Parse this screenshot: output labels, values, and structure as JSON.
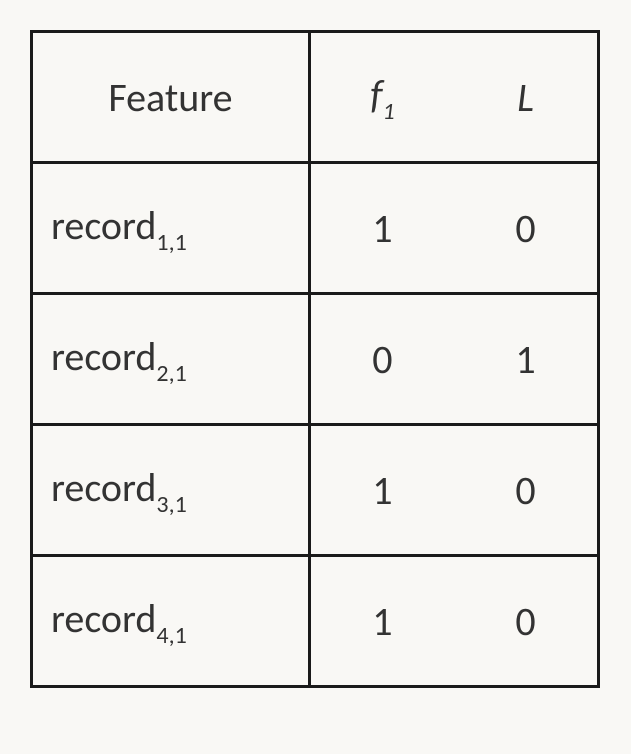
{
  "chart_data": {
    "type": "table",
    "columns": [
      "Feature",
      "f1",
      "L"
    ],
    "rows": [
      {
        "feature": "record_{1,1}",
        "f1": 1,
        "L": 0
      },
      {
        "feature": "record_{2,1}",
        "f1": 0,
        "L": 1
      },
      {
        "feature": "record_{3,1}",
        "f1": 1,
        "L": 0
      },
      {
        "feature": "record_{4,1}",
        "f1": 1,
        "L": 0
      }
    ]
  },
  "header": {
    "feature": "Feature",
    "f_letter": "f",
    "f_sub": "1",
    "L": "L"
  },
  "rows": [
    {
      "prefix": "record",
      "sub": "1,1",
      "f1": "1",
      "L": "0"
    },
    {
      "prefix": "record",
      "sub": "2,1",
      "f1": "0",
      "L": "1"
    },
    {
      "prefix": "record",
      "sub": "3,1",
      "f1": "1",
      "L": "0"
    },
    {
      "prefix": "record",
      "sub": "4,1",
      "f1": "1",
      "L": "0"
    }
  ]
}
